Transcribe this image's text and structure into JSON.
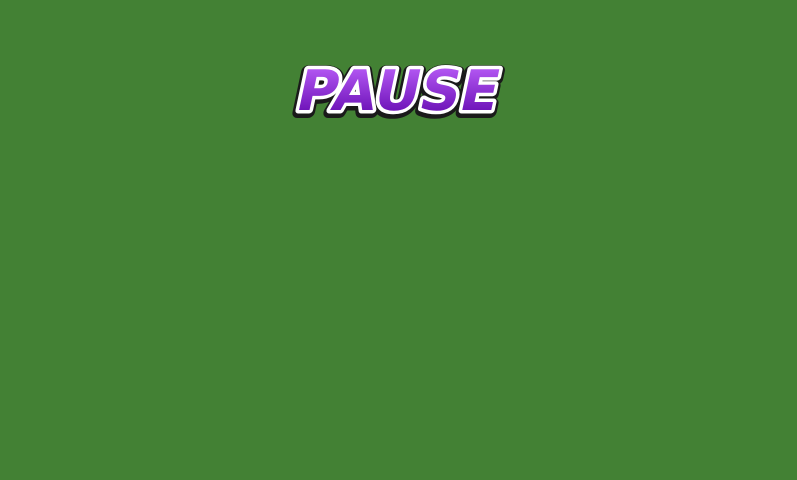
{
  "screen": {
    "background_color": "#438134"
  },
  "title": {
    "text": "PAUSE",
    "fill_top_color": "#c266ff",
    "fill_bottom_color": "#5a00a8",
    "outline_color": "#ffffff",
    "shadow_color": "#1a1a1a"
  }
}
